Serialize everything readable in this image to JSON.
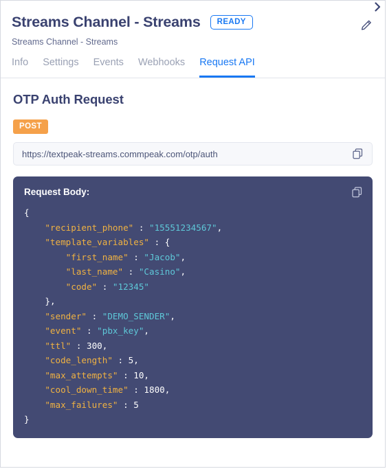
{
  "window": {
    "collapse_icon": "chevron-right-icon"
  },
  "header": {
    "title": "Streams Channel - Streams",
    "status_badge": "READY",
    "subtitle": "Streams Channel - Streams",
    "edit_icon": "pencil-icon"
  },
  "tabs": [
    {
      "label": "Info",
      "active": false
    },
    {
      "label": "Settings",
      "active": false
    },
    {
      "label": "Events",
      "active": false
    },
    {
      "label": "Webhooks",
      "active": false
    },
    {
      "label": "Request API",
      "active": true
    }
  ],
  "main": {
    "section_title": "OTP Auth Request",
    "method": "POST",
    "url": "https://textpeak-streams.commpeak.com/otp/auth",
    "url_copy_icon": "copy-icon",
    "code_header": "Request Body:",
    "code_copy_icon": "copy-icon",
    "request_body": {
      "recipient_phone": "15551234567",
      "template_variables": {
        "first_name": "Jacob",
        "last_name": "Casino",
        "code": "12345"
      },
      "sender": "DEMO_SENDER",
      "event": "pbx_key",
      "ttl": 300,
      "code_length": 5,
      "max_attempts": 10,
      "cool_down_time": 1800,
      "max_failures": 5
    }
  },
  "colors": {
    "accent_blue": "#1878f3",
    "title_navy": "#3a4270",
    "method_orange": "#f5a14a",
    "code_bg": "#434a73",
    "json_key": "#f0b242",
    "json_string": "#5ec8d8",
    "json_number": "#ffffff"
  }
}
